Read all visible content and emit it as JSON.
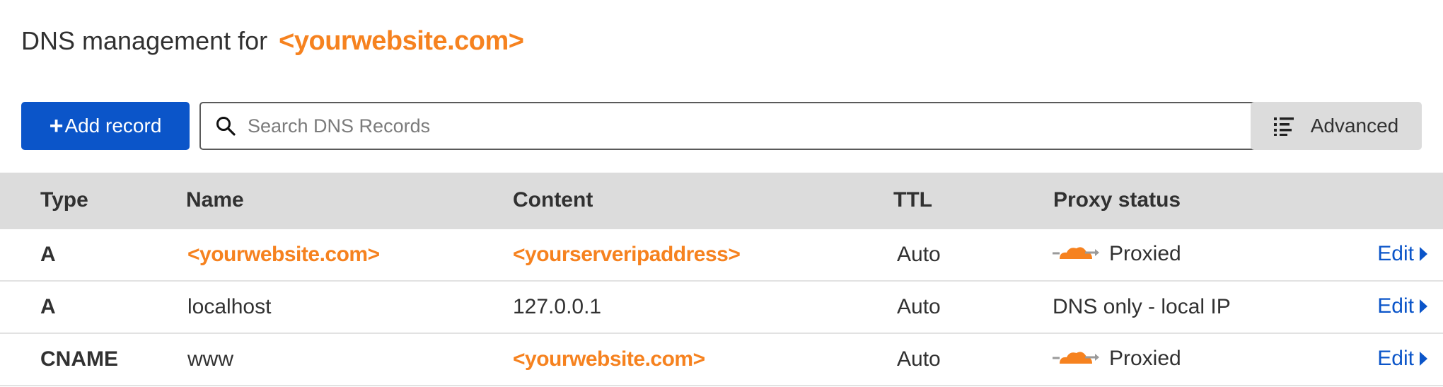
{
  "header": {
    "title": "DNS management for",
    "domain": "<yourwebsite.com>"
  },
  "toolbar": {
    "add_label": "Add record",
    "add_icon": "plus-icon",
    "search_placeholder": "Search DNS Records",
    "search_value": "",
    "advanced_label": "Advanced",
    "advanced_icon": "list-icon"
  },
  "colors": {
    "accent_blue": "#0b55c9",
    "brand_orange": "#f6821f",
    "header_gray": "#dcdcdc"
  },
  "table": {
    "columns": [
      "Type",
      "Name",
      "Content",
      "TTL",
      "Proxy status"
    ],
    "rows": [
      {
        "type": "A",
        "name": "<yourwebsite.com>",
        "content": "<yourserveripaddress>",
        "ttl": "Auto",
        "proxy": "Proxied",
        "proxied": true,
        "edit": "Edit"
      },
      {
        "type": "A",
        "name": "localhost",
        "content": "127.0.0.1",
        "ttl": "Auto",
        "proxy": "DNS only - local IP",
        "proxied": false,
        "edit": "Edit"
      },
      {
        "type": "CNAME",
        "name": "www",
        "content": "<yourwebsite.com>",
        "ttl": "Auto",
        "proxy": "Proxied",
        "proxied": true,
        "edit": "Edit"
      }
    ]
  }
}
